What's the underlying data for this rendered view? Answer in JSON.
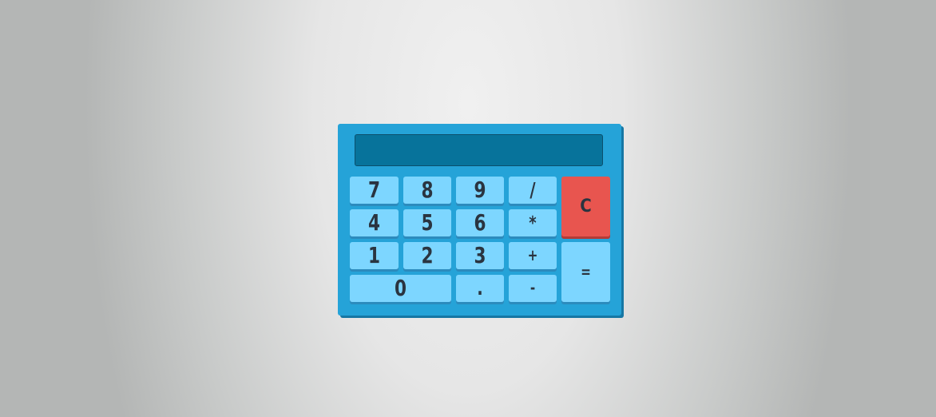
{
  "display": {
    "value": ""
  },
  "keys": {
    "k7": "7",
    "k8": "8",
    "k9": "9",
    "divide": "/",
    "clear": "C",
    "k4": "4",
    "k5": "5",
    "k6": "6",
    "multiply": "*",
    "k1": "1",
    "k2": "2",
    "k3": "3",
    "plus": "+",
    "equals": "=",
    "k0": "0",
    "decimal": ".",
    "minus": "-"
  },
  "colors": {
    "body": "#25a3d8",
    "display": "#07739b",
    "key": "#7dd6ff",
    "clear_key": "#e8554f"
  }
}
